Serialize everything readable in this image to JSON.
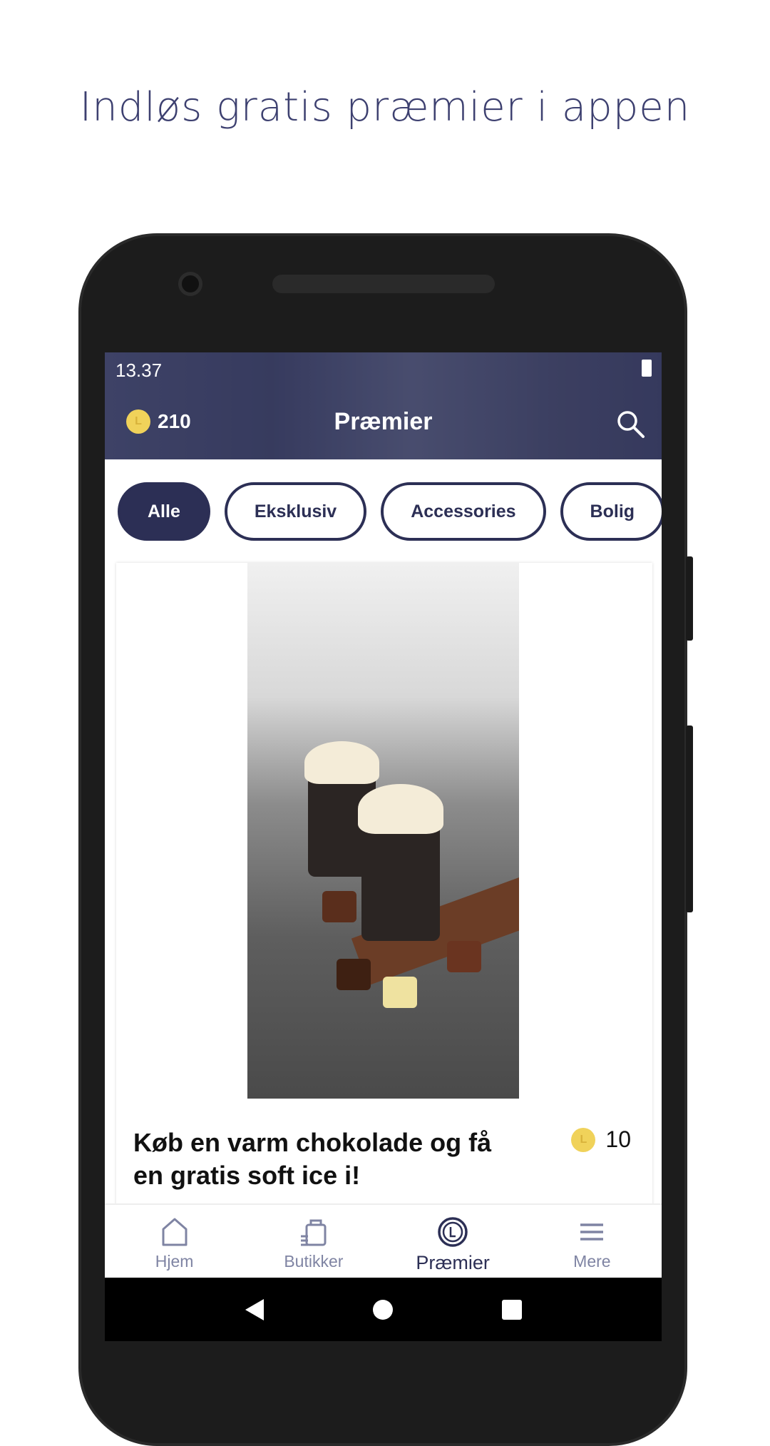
{
  "headline": "Indløs gratis præmier i appen",
  "status_bar": {
    "time": "13.37"
  },
  "header": {
    "points": "210",
    "title": "Præmier",
    "coin_letter": "L"
  },
  "filters": [
    {
      "label": "Alle",
      "active": true
    },
    {
      "label": "Eksklusiv",
      "active": false
    },
    {
      "label": "Accessories",
      "active": false
    },
    {
      "label": "Bolig",
      "active": false
    }
  ],
  "reward": {
    "title": "Køb en varm chokolade og få en gratis soft ice i!",
    "price": "10"
  },
  "bottom_nav": [
    {
      "label": "Hjem",
      "icon": "home-icon"
    },
    {
      "label": "Butikker",
      "icon": "shopping-bag-icon"
    },
    {
      "label": "Præmier",
      "icon": "coin-icon",
      "active": true
    },
    {
      "label": "Mere",
      "icon": "menu-icon"
    }
  ],
  "colors": {
    "brand": "#2c2f55",
    "coin": "#f0d25a",
    "inactive": "#7f84a3"
  }
}
